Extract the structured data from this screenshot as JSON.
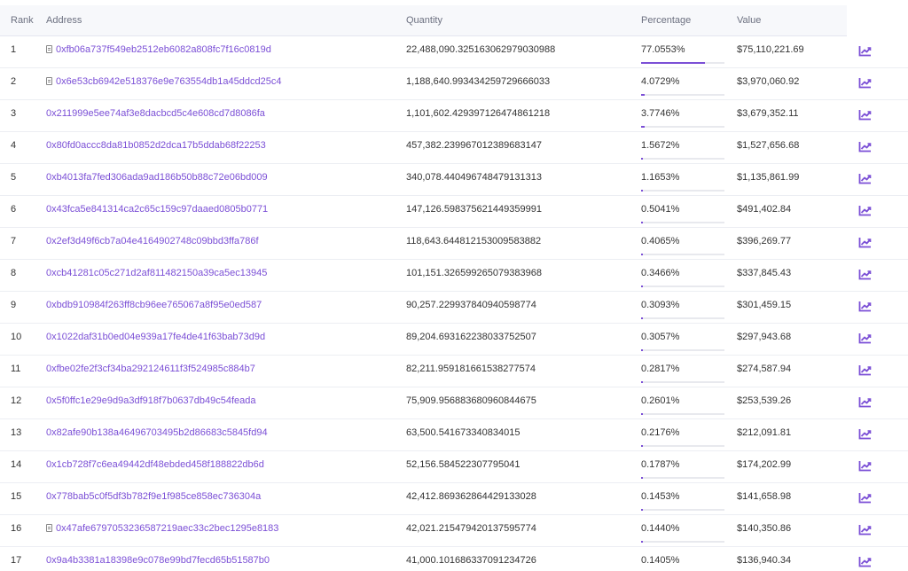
{
  "table": {
    "headers": {
      "rank": "Rank",
      "address": "Address",
      "quantity": "Quantity",
      "percentage": "Percentage",
      "value": "Value"
    },
    "rows": [
      {
        "rank": "1",
        "address": "0xfb06a737f549eb2512eb6082a808fc7f16c0819d",
        "contract": true,
        "quantity": "22,488,090.325163062979030988",
        "percentage": "77.0553%",
        "pct": 77.0553,
        "value": "$75,110,221.69"
      },
      {
        "rank": "2",
        "address": "0x6e53cb6942e518376e9e763554db1a45ddcd25c4",
        "contract": true,
        "quantity": "1,188,640.993434259729666033",
        "percentage": "4.0729%",
        "pct": 4.0729,
        "value": "$3,970,060.92"
      },
      {
        "rank": "3",
        "address": "0x211999e5ee74af3e8dacbcd5c4e608cd7d8086fa",
        "contract": false,
        "quantity": "1,101,602.429397126474861218",
        "percentage": "3.7746%",
        "pct": 3.7746,
        "value": "$3,679,352.11"
      },
      {
        "rank": "4",
        "address": "0x80fd0accc8da81b0852d2dca17b5ddab68f22253",
        "contract": false,
        "quantity": "457,382.239967012389683147",
        "percentage": "1.5672%",
        "pct": 1.5672,
        "value": "$1,527,656.68"
      },
      {
        "rank": "5",
        "address": "0xb4013fa7fed306ada9ad186b50b88c72e06bd009",
        "contract": false,
        "quantity": "340,078.440496748479131313",
        "percentage": "1.1653%",
        "pct": 1.1653,
        "value": "$1,135,861.99"
      },
      {
        "rank": "6",
        "address": "0x43fca5e841314ca2c65c159c97daaed0805b0771",
        "contract": false,
        "quantity": "147,126.598375621449359991",
        "percentage": "0.5041%",
        "pct": 0.5041,
        "value": "$491,402.84"
      },
      {
        "rank": "7",
        "address": "0x2ef3d49f6cb7a04e4164902748c09bbd3ffa786f",
        "contract": false,
        "quantity": "118,643.644812153009583882",
        "percentage": "0.4065%",
        "pct": 0.4065,
        "value": "$396,269.77"
      },
      {
        "rank": "8",
        "address": "0xcb41281c05c271d2af811482150a39ca5ec13945",
        "contract": false,
        "quantity": "101,151.326599265079383968",
        "percentage": "0.3466%",
        "pct": 0.3466,
        "value": "$337,845.43"
      },
      {
        "rank": "9",
        "address": "0xbdb910984f263ff8cb96ee765067a8f95e0ed587",
        "contract": false,
        "quantity": "90,257.229937840940598774",
        "percentage": "0.3093%",
        "pct": 0.3093,
        "value": "$301,459.15"
      },
      {
        "rank": "10",
        "address": "0x1022daf31b0ed04e939a17fe4de41f63bab73d9d",
        "contract": false,
        "quantity": "89,204.693162238033752507",
        "percentage": "0.3057%",
        "pct": 0.3057,
        "value": "$297,943.68"
      },
      {
        "rank": "11",
        "address": "0xfbe02fe2f3cf34ba292124611f3f524985c884b7",
        "contract": false,
        "quantity": "82,211.959181661538277574",
        "percentage": "0.2817%",
        "pct": 0.2817,
        "value": "$274,587.94"
      },
      {
        "rank": "12",
        "address": "0x5f0ffc1e29e9d9a3df918f7b0637db49c54feada",
        "contract": false,
        "quantity": "75,909.956883680960844675",
        "percentage": "0.2601%",
        "pct": 0.2601,
        "value": "$253,539.26"
      },
      {
        "rank": "13",
        "address": "0x82afe90b138a46496703495b2d86683c5845fd94",
        "contract": false,
        "quantity": "63,500.541673340834015",
        "percentage": "0.2176%",
        "pct": 0.2176,
        "value": "$212,091.81"
      },
      {
        "rank": "14",
        "address": "0x1cb728f7c6ea49442df48ebded458f188822db6d",
        "contract": false,
        "quantity": "52,156.584522307795041",
        "percentage": "0.1787%",
        "pct": 0.1787,
        "value": "$174,202.99"
      },
      {
        "rank": "15",
        "address": "0x778bab5c0f5df3b782f9e1f985ce858ec736304a",
        "contract": false,
        "quantity": "42,412.869362864429133028",
        "percentage": "0.1453%",
        "pct": 0.1453,
        "value": "$141,658.98"
      },
      {
        "rank": "16",
        "address": "0x47afe6797053236587219aec33c2bec1295e8183",
        "contract": true,
        "quantity": "42,021.215479420137595774",
        "percentage": "0.1440%",
        "pct": 0.144,
        "value": "$140,350.86"
      },
      {
        "rank": "17",
        "address": "0x9a4b3381a18398e9c078e99bd7fecd65b51587b0",
        "contract": false,
        "quantity": "41,000.101686337091234726",
        "percentage": "0.1405%",
        "pct": 0.1405,
        "value": "$136,940.34"
      }
    ]
  },
  "icons": {
    "contract": "document-icon",
    "analytics": "chart-line-icon"
  },
  "colors": {
    "accent": "#7b4fd6",
    "header_bg": "#f7f8fb",
    "bar_track": "#e8e9ee"
  }
}
